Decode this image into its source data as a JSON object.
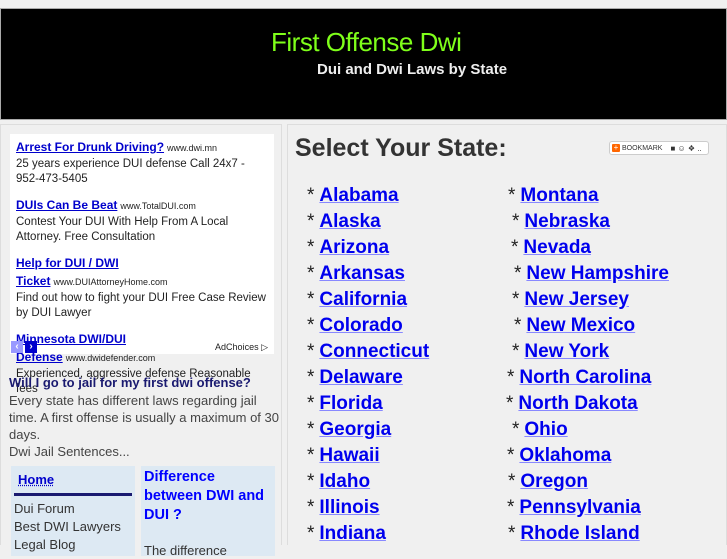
{
  "header": {
    "title": "First Offense Dwi",
    "subtitle": "Dui and Dwi Laws by State"
  },
  "ads": [
    {
      "title": "Arrest For Drunk Driving?",
      "url": "www.dwi.mn",
      "desc": "25 years experience DUI defense Call 24x7 - 952-473-5405"
    },
    {
      "title": "DUIs Can Be Beat",
      "url": "www.TotalDUI.com",
      "desc": "Contest Your DUI With Help From A Local Attorney. Free Consultation"
    },
    {
      "title": "Help for DUI / DWI Ticket",
      "url": "www.DUIAttorneyHome.com",
      "desc": "Find out how to fight your DUI Free Case Review by DUI Lawyer"
    },
    {
      "title": "Minnesota DWI/DUI Defense",
      "url": "www.dwidefender.com",
      "desc": "Experienced, aggressive defense Reasonable fees"
    }
  ],
  "ad_controls": {
    "prev": "‹",
    "next": "›",
    "adchoices": "AdChoices ▷"
  },
  "faq": {
    "question": "Will I go to jail for my first dwi offense?",
    "answer": "Every state has different laws regarding jail time. A first offense is usually a maximum of 30 days.",
    "more": "Dwi Jail Sentences..."
  },
  "nav": {
    "home": "Home",
    "items": [
      "Dui Forum",
      "Best DWI Lawyers",
      "Legal Blog"
    ]
  },
  "diff": {
    "title": "Difference between DWI and DUI ?",
    "text": "The difference"
  },
  "main": {
    "title": "Select Your State:",
    "bookmark": "BOOKMARK"
  },
  "states_left": [
    "Alabama",
    "Alaska",
    "Arizona",
    "Arkansas",
    "California",
    "Colorado",
    "Connecticut",
    "Delaware",
    "Florida",
    "Georgia",
    "Hawaii",
    "Idaho",
    "Illinois",
    "Indiana"
  ],
  "states_right": [
    "Montana",
    "Nebraska",
    "Nevada",
    "New Hampshire",
    "New Jersey",
    "New Mexico",
    "New York",
    "North Carolina",
    "North Dakota",
    "Ohio",
    "Oklahoma",
    "Oregon",
    "Pennsylvania",
    "Rhode Island"
  ],
  "colors": {
    "title": "#7fff1a",
    "link": "#0000ee",
    "header_bg": "#000000"
  }
}
